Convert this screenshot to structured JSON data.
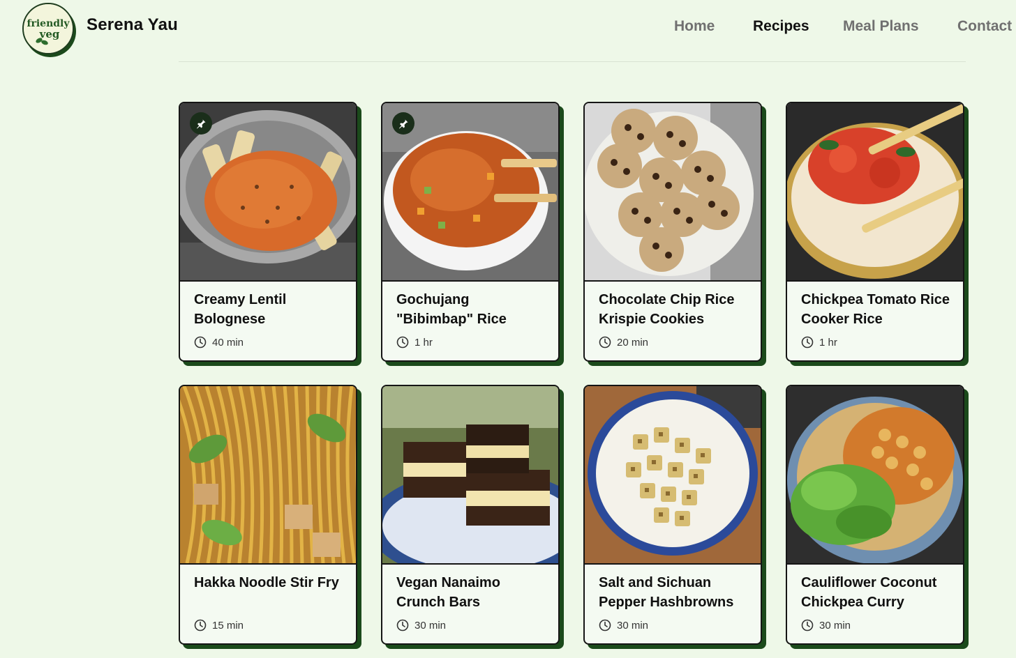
{
  "header": {
    "logo_text_top": "friendly",
    "logo_text_bottom": "veg",
    "site_name": "Serena Yau",
    "nav": [
      {
        "label": "Home",
        "active": false
      },
      {
        "label": "Recipes",
        "active": true
      },
      {
        "label": "Meal Plans",
        "active": false
      },
      {
        "label": "Contact",
        "active": false
      }
    ]
  },
  "colors": {
    "background": "#eef8e8",
    "card_background": "#f4faf2",
    "card_shadow": "#1b4a1b",
    "text_dark": "#101010",
    "nav_inactive": "#707070"
  },
  "recipes": [
    {
      "title": "Creamy Lentil Bolognese",
      "time": "40 min",
      "pinned": true,
      "image": "lentil-bolognese-pot"
    },
    {
      "title": "Gochujang \"Bibimbap\" Rice",
      "time": "1 hr",
      "pinned": true,
      "image": "gochujang-rice-bowl"
    },
    {
      "title": "Chocolate Chip Rice Krispie Cookies",
      "time": "20 min",
      "pinned": false,
      "image": "cookies-plate"
    },
    {
      "title": "Chickpea Tomato Rice Cooker Rice",
      "time": "1 hr",
      "pinned": false,
      "image": "tomato-rice-bowl"
    },
    {
      "title": "Hakka Noodle Stir Fry",
      "time": "15 min",
      "pinned": false,
      "image": "noodle-stir-fry"
    },
    {
      "title": "Vegan Nanaimo Crunch Bars",
      "time": "30 min",
      "pinned": false,
      "image": "nanaimo-bars"
    },
    {
      "title": "Salt and Sichuan Pepper Hashbrowns",
      "time": "30 min",
      "pinned": false,
      "image": "hashbrowns-bowl"
    },
    {
      "title": "Cauliflower Coconut Chickpea Curry",
      "time": "30 min",
      "pinned": false,
      "image": "chickpea-curry"
    }
  ]
}
